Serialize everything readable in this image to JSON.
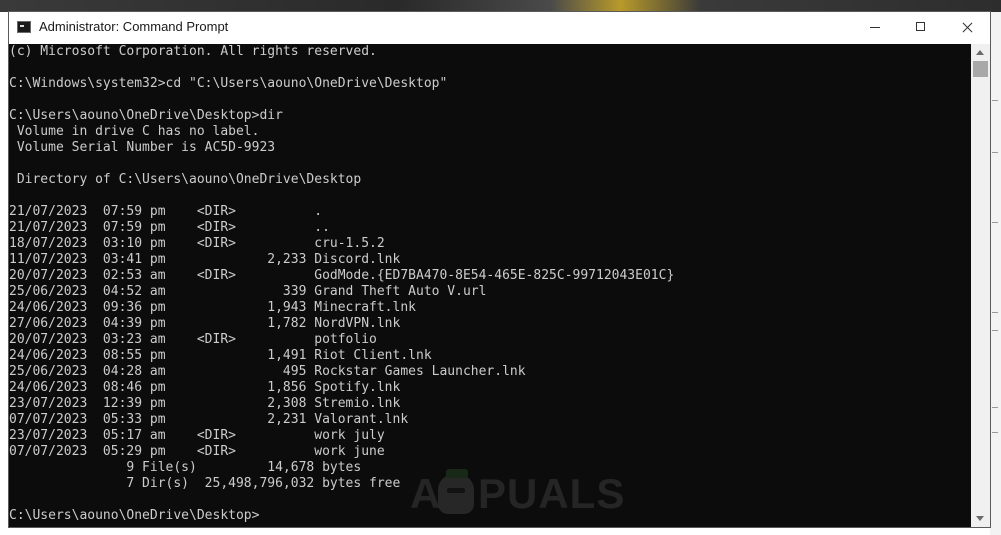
{
  "window": {
    "title": "Administrator: Command Prompt",
    "controls": {
      "minimize": "minimize",
      "maximize": "maximize",
      "close": "close"
    }
  },
  "console": {
    "lines": [
      "(c) Microsoft Corporation. All rights reserved.",
      "",
      "C:\\Windows\\system32>cd \"C:\\Users\\aouno\\OneDrive\\Desktop\"",
      "",
      "C:\\Users\\aouno\\OneDrive\\Desktop>dir",
      " Volume in drive C has no label.",
      " Volume Serial Number is AC5D-9923",
      "",
      " Directory of C:\\Users\\aouno\\OneDrive\\Desktop",
      "",
      "21/07/2023  07:59 pm    <DIR>          .",
      "21/07/2023  07:59 pm    <DIR>          ..",
      "18/07/2023  03:10 pm    <DIR>          cru-1.5.2",
      "11/07/2023  03:41 pm             2,233 Discord.lnk",
      "20/07/2023  02:53 am    <DIR>          GodMode.{ED7BA470-8E54-465E-825C-99712043E01C}",
      "25/06/2023  04:52 am               339 Grand Theft Auto V.url",
      "24/06/2023  09:36 pm             1,943 Minecraft.lnk",
      "27/06/2023  04:39 pm             1,782 NordVPN.lnk",
      "20/07/2023  03:23 am    <DIR>          potfolio",
      "24/06/2023  08:55 pm             1,491 Riot Client.lnk",
      "25/06/2023  04:28 am               495 Rockstar Games Launcher.lnk",
      "24/06/2023  08:46 pm             1,856 Spotify.lnk",
      "23/07/2023  12:39 pm             2,308 Stremio.lnk",
      "07/07/2023  05:33 pm             2,231 Valorant.lnk",
      "23/07/2023  05:17 am    <DIR>          work july",
      "07/07/2023  05:29 pm    <DIR>          work june",
      "               9 File(s)         14,678 bytes",
      "               7 Dir(s)  25,498,796,032 bytes free",
      "",
      "C:\\Users\\aouno\\OneDrive\\Desktop>"
    ]
  },
  "watermark": {
    "text_pre": "A",
    "text_post": "PUALS"
  },
  "colors": {
    "console_bg": "#0c0c0c",
    "console_text": "#cccccc",
    "titlebar_bg": "#ffffff"
  }
}
